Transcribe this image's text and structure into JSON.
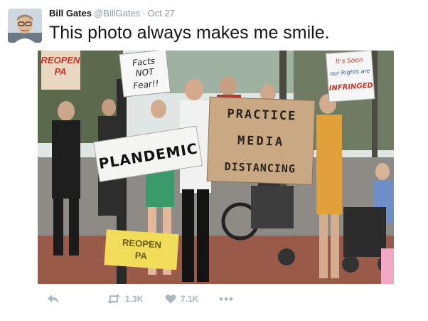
{
  "tweet": {
    "author_name": "Bill Gates",
    "author_handle": "@BillGates",
    "separator": "·",
    "date": "Oct 27",
    "text": "This photo always makes me smile.",
    "avatar_icon": "profile-photo",
    "media": {
      "sign_left_top": "REOPEN\nPA",
      "sign_facts": "Facts\nNOT\nFear!!",
      "sign_plandemic": "PLANDEMIC",
      "sign_practice": "PRACTICE\nMEDIA\nDISTANCING",
      "sign_right_top": "It's Soon\nour Rights are\nINFRINGED",
      "sign_bottom": "REOPEN\nPA"
    }
  },
  "actions": {
    "reply_icon": "reply-icon",
    "retweet_icon": "retweet-icon",
    "retweet_count": "1.3K",
    "like_icon": "heart-icon",
    "like_count": "7.1K",
    "more_icon": "more-icon"
  },
  "colors": {
    "name": "#14171a",
    "muted": "#8899a6",
    "action": "#aab8c2"
  }
}
